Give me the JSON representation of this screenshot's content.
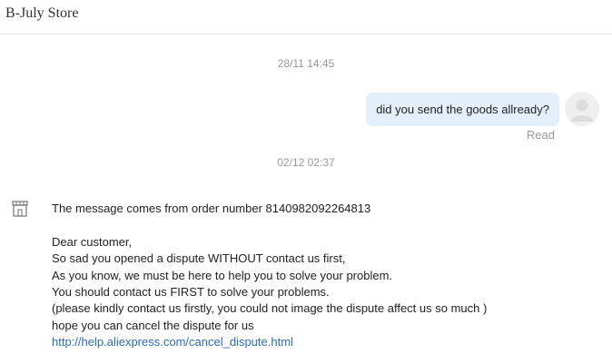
{
  "header": {
    "title": "B-July Store"
  },
  "messages": {
    "outgoing_timestamp": "28/11 14:45",
    "outgoing_text": "did you send the goods allready?",
    "read_status": "Read",
    "incoming_timestamp": "02/12 02:37",
    "incoming_icon": "store-icon",
    "incoming_lines": [
      "The message comes from order number 8140982092264813",
      "",
      "Dear customer,",
      "So sad you opened a dispute WITHOUT contact us first,",
      "As you know, we must be here to help you to solve your problem.",
      "You should contact us FIRST to solve your problems.",
      "(please kindly contact us firstly, you could not image the dispute affect us so much )",
      "hope you can cancel the dispute for us"
    ],
    "incoming_link": "http://help.aliexpress.com/cancel_dispute.html"
  },
  "colors": {
    "outgoing_bubble": "#e3f0fc",
    "link": "#2a6cb8",
    "timestamp": "#999999"
  }
}
